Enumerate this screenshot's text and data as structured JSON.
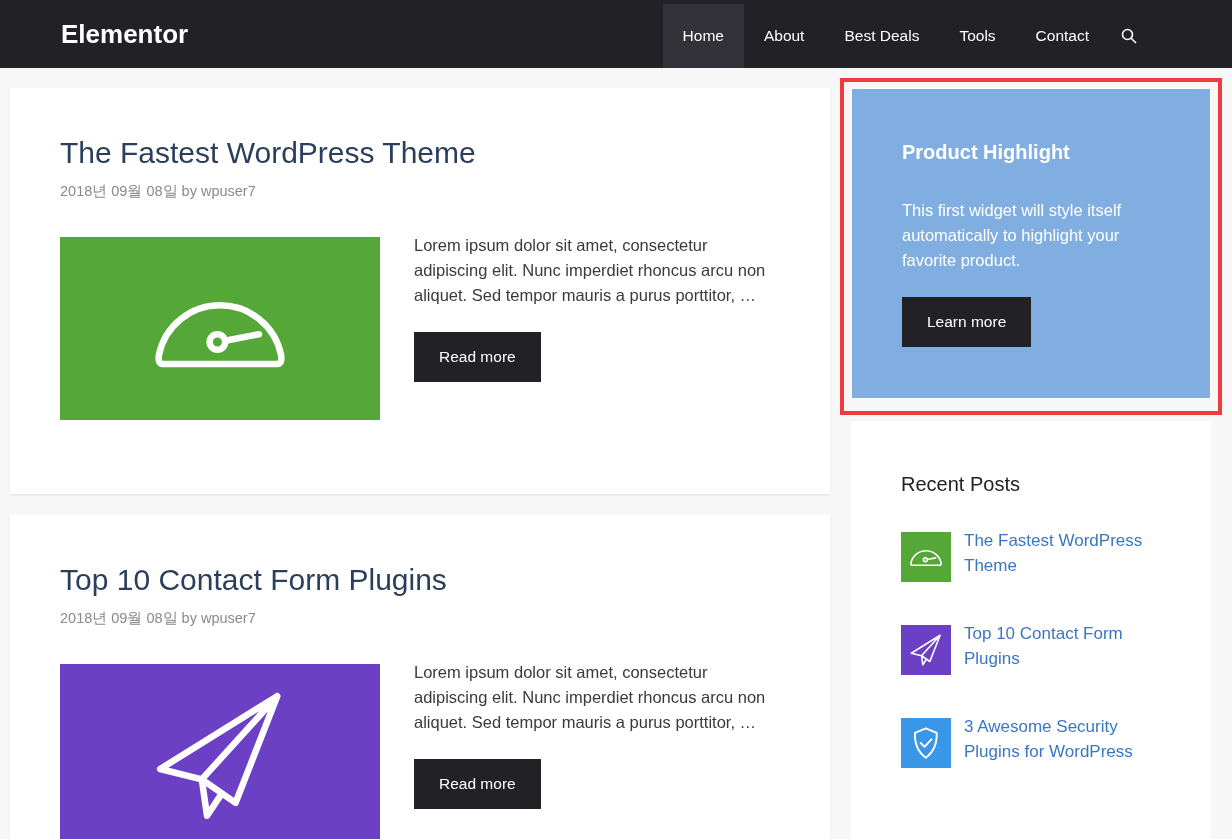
{
  "site_title": "Elementor",
  "nav": [
    {
      "label": "Home",
      "selected": true
    },
    {
      "label": "About",
      "selected": false
    },
    {
      "label": "Best Deals",
      "selected": false
    },
    {
      "label": "Tools",
      "selected": false
    },
    {
      "label": "Contact",
      "selected": false
    }
  ],
  "posts": [
    {
      "title": "The Fastest WordPress Theme",
      "meta": "2018년 09월 08일 by wpuser7",
      "image": {
        "kind": "gauge",
        "color": "#55a737"
      },
      "excerpt": "Lorem ipsum dolor sit amet, consectetur adipiscing elit. Nunc imperdiet rhoncus arcu non aliquet. Sed tempor mauris a purus porttitor, …",
      "button": "Read more"
    },
    {
      "title": "Top 10 Contact Form Plugins",
      "meta": "2018년 09월 08일 by wpuser7",
      "image": {
        "kind": "plane",
        "color": "#6b40c4"
      },
      "excerpt": "Lorem ipsum dolor sit amet, consectetur adipiscing elit. Nunc imperdiet rhoncus arcu non aliquet. Sed tempor mauris a purus porttitor, …",
      "button": "Read more"
    }
  ],
  "highlight_widget": {
    "highlighted": true,
    "title": "Product Highlight",
    "text": "This first widget will style itself automatically to highlight your favorite product.",
    "button": "Learn more"
  },
  "recent_posts": {
    "title": "Recent Posts",
    "items": [
      {
        "title": "The Fastest WordPress Theme",
        "kind": "gauge",
        "color": "#55a737"
      },
      {
        "title": "Top 10 Contact Form Plugins",
        "kind": "plane",
        "color": "#6b40c4"
      },
      {
        "title": "3 Awesome Security Plugins for WordPress",
        "kind": "shield",
        "color": "#3a97e8"
      }
    ]
  }
}
